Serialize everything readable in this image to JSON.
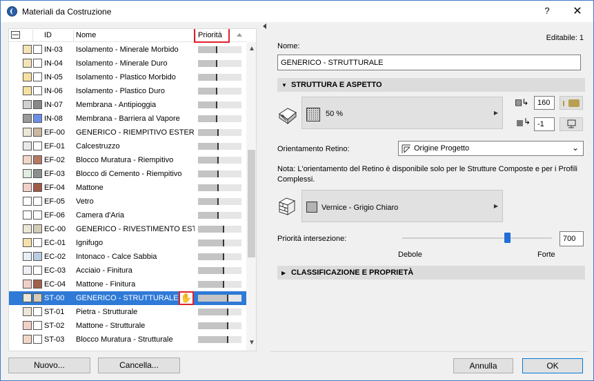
{
  "window": {
    "title": "Materiali da Costruzione",
    "help": "?",
    "close": "✕"
  },
  "list": {
    "headers": {
      "id": "ID",
      "name": "Nome",
      "priority": "Priorità"
    },
    "rows": [
      {
        "id": "IN-03",
        "name": "Isolamento - Minerale Morbido",
        "c1": "#f4e3b6",
        "c2": "#ffffff",
        "prio": 0.45
      },
      {
        "id": "IN-04",
        "name": "Isolamento - Minerale Duro",
        "c1": "#f4e3b6",
        "c2": "#ffffff",
        "prio": 0.45
      },
      {
        "id": "IN-05",
        "name": "Isolamento - Plastico Morbido",
        "c1": "#f7e0a0",
        "c2": "#ffffff",
        "prio": 0.45
      },
      {
        "id": "IN-06",
        "name": "Isolamento - Plastico Duro",
        "c1": "#f7e0a0",
        "c2": "#ffffff",
        "prio": 0.45
      },
      {
        "id": "IN-07",
        "name": "Membrana - Antipioggia",
        "c1": "#d0d0d0",
        "c2": "#888888",
        "prio": 0.45
      },
      {
        "id": "IN-08",
        "name": "Membrana - Barriera al Vapore",
        "c1": "#9a9a9a",
        "c2": "#6b8ee8",
        "prio": 0.45
      },
      {
        "id": "EF-00",
        "name": "GENERICO - RIEMPITIVO ESTERNO",
        "c1": "#ece6d6",
        "c2": "#c9b9a0",
        "prio": 0.48
      },
      {
        "id": "EF-01",
        "name": "Calcestruzzo",
        "c1": "#e9e9e9",
        "c2": "#ffffff",
        "prio": 0.48
      },
      {
        "id": "EF-02",
        "name": "Blocco Muratura - Riempitivo",
        "c1": "#f2d7c8",
        "c2": "#b57a64",
        "prio": 0.48
      },
      {
        "id": "EF-03",
        "name": "Blocco di Cemento - Riempitivo",
        "c1": "#dfeee0",
        "c2": "#8a9090",
        "prio": 0.48
      },
      {
        "id": "EF-04",
        "name": "Mattone",
        "c1": "#f2d0c8",
        "c2": "#a05a45",
        "prio": 0.48
      },
      {
        "id": "EF-05",
        "name": "Vetro",
        "c1": "#ffffff",
        "c2": "#ffffff",
        "prio": 0.48
      },
      {
        "id": "EF-06",
        "name": "Camera d'Aria",
        "c1": "#ffffff",
        "c2": "#ffffff",
        "prio": 0.48
      },
      {
        "id": "EC-00",
        "name": "GENERICO - RIVESTIMENTO ESTERNO",
        "c1": "#ece6d6",
        "c2": "#d4cbb8",
        "prio": 0.6
      },
      {
        "id": "EC-01",
        "name": "Ignifugo",
        "c1": "#f6e2a8",
        "c2": "#ffffff",
        "prio": 0.6
      },
      {
        "id": "EC-02",
        "name": "Intonaco - Calce Sabbia",
        "c1": "#e8eef6",
        "c2": "#b9cde3",
        "prio": 0.6
      },
      {
        "id": "EC-03",
        "name": "Acciaio - Finitura",
        "c1": "#eef0f5",
        "c2": "#ffffff",
        "prio": 0.6
      },
      {
        "id": "EC-04",
        "name": "Mattone - Finitura",
        "c1": "#f2d0c8",
        "c2": "#a0624c",
        "prio": 0.6
      },
      {
        "id": "ST-00",
        "name": "GENERICO - STRUTTURALE",
        "c1": "#ece6d6",
        "c2": "#d4cbb8",
        "prio": 0.7,
        "selected": true
      },
      {
        "id": "ST-01",
        "name": "Pietra - Strutturale",
        "c1": "#ece6d6",
        "c2": "#ffffff",
        "prio": 0.7
      },
      {
        "id": "ST-02",
        "name": "Mattone - Strutturale",
        "c1": "#f2d0c8",
        "c2": "#ffffff",
        "prio": 0.7
      },
      {
        "id": "ST-03",
        "name": "Blocco Muratura - Strutturale",
        "c1": "#f2d7c8",
        "c2": "#ffffff",
        "prio": 0.7
      }
    ]
  },
  "buttons": {
    "new": "Nuovo...",
    "delete": "Cancella...",
    "cancel": "Annulla",
    "ok": "OK"
  },
  "details": {
    "editable": "Editabile: 1",
    "name_label": "Nome:",
    "name_value": "GENERICO - STRUTTURALE",
    "section_structure": "STRUTTURA E ASPETTO",
    "fill_percent": "50 %",
    "pen_value": "160",
    "bg_pen_value": "-1",
    "orientation_label": "Orientamento Retino:",
    "orientation_value": "Origine Progetto",
    "note": "Nota: L'orientamento del Retino è disponibile solo per le Strutture Composte e per i Profili Complessi.",
    "surface_value": "Vernice - Grigio Chiaro",
    "intersection_label": "Priorità intersezione:",
    "intersection_value": "700",
    "slider_level": 0.7,
    "weak": "Debole",
    "strong": "Forte",
    "section_classification": "CLASSIFICAZIONE E PROPRIETÀ"
  }
}
